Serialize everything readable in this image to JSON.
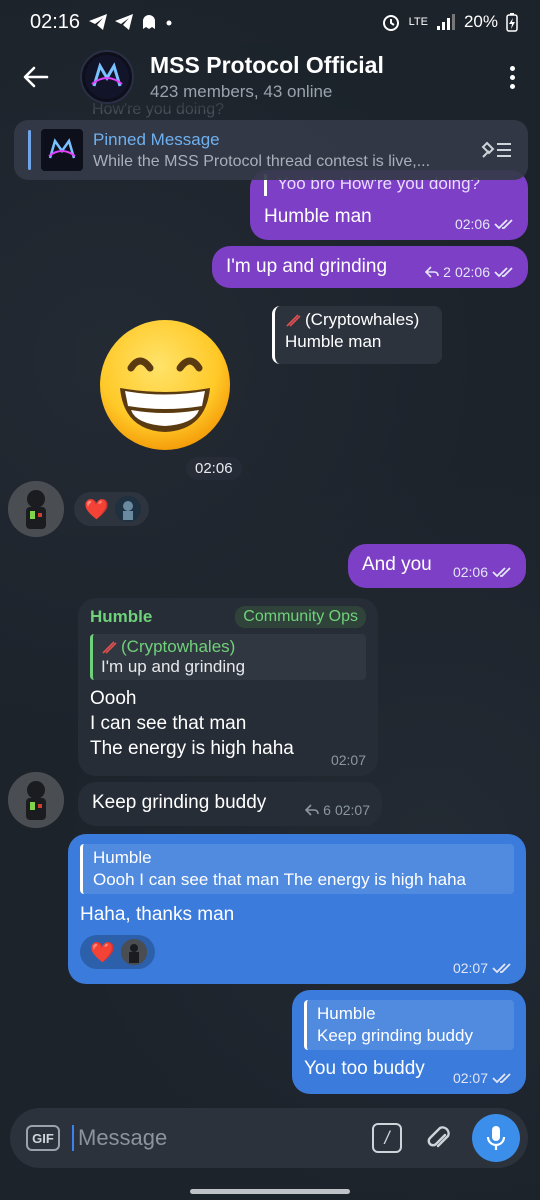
{
  "status_bar": {
    "time": "02:16",
    "notification_icons": "telegram-icon telegram-icon ghost-icon dot",
    "network": "LTE",
    "battery": "20%"
  },
  "header": {
    "title": "MSS Protocol Official",
    "subtitle": "423 members, 43 online"
  },
  "ghost_text": "How're you doing?",
  "pinned": {
    "title": "Pinned Message",
    "body": "While the MSS Protocol thread contest is live,..."
  },
  "messages": {
    "m1": {
      "reply_text": "Yoo bro  How're you doing?",
      "text": "Humble man",
      "time": "02:06"
    },
    "m2": {
      "text": "I'm up and grinding",
      "reply_count": "2",
      "time": "02:06"
    },
    "m3": {
      "reply_name": "(Cryptowhales)",
      "reply_text": "Humble man"
    },
    "m4": {
      "emoji": "😁",
      "time": "02:06"
    },
    "m5": {
      "reactions": [
        "❤️"
      ]
    },
    "m6": {
      "text": "And you",
      "time": "02:06"
    },
    "m7": {
      "sender": "Humble",
      "tag": "Community Ops",
      "reply_name": "(Cryptowhales)",
      "reply_text": "I'm up and grinding",
      "lines": [
        "Oooh",
        "I can see that man",
        "The energy is high haha"
      ],
      "time": "02:07"
    },
    "m8": {
      "text": "Keep grinding buddy",
      "reply_count": "6",
      "time": "02:07"
    },
    "m9": {
      "reply_name": "Humble",
      "reply_text": "Oooh  I can see that man  The energy is high haha",
      "text": "Haha, thanks man",
      "reactions": [
        "❤️"
      ],
      "time": "02:07"
    },
    "m10": {
      "reply_name": "Humble",
      "reply_text": "Keep grinding buddy",
      "text": "You too buddy",
      "time": "02:07"
    }
  },
  "input": {
    "gif_label": "GIF",
    "placeholder": "Message",
    "command_glyph": "/"
  },
  "colors": {
    "outgoing_purple": "#7d3fc6",
    "outgoing_blue": "#3a7bdb",
    "incoming": "#262d36",
    "accent": "#3b8eea",
    "role_tag": "#6fd17a"
  }
}
